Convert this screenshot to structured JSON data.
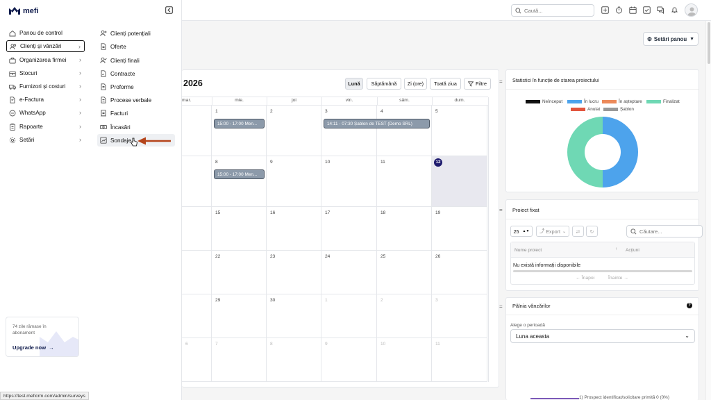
{
  "brand": {
    "name": "mefi"
  },
  "sidebar": {
    "items": [
      {
        "label": "Panou de control",
        "icon": "home-icon"
      },
      {
        "label": "Clienți și vânzări",
        "icon": "users-icon",
        "active": true,
        "chevron": true
      },
      {
        "label": "Organizarea firmei",
        "icon": "briefcase-icon",
        "chevron": true
      },
      {
        "label": "Stocuri",
        "icon": "box-icon",
        "chevron": true
      },
      {
        "label": "Furnizori și costuri",
        "icon": "truck-icon",
        "chevron": true
      },
      {
        "label": "e-Factura",
        "icon": "file-icon",
        "chevron": true
      },
      {
        "label": "WhatsApp",
        "icon": "chat-icon",
        "chevron": true
      },
      {
        "label": "Rapoarte",
        "icon": "report-icon",
        "chevron": true
      },
      {
        "label": "Setări",
        "icon": "gear-icon",
        "chevron": true
      }
    ],
    "subscription": {
      "text": "74 zile rămase în abonament",
      "upgrade_label": "Upgrade now"
    }
  },
  "submenu": {
    "items": [
      {
        "label": "Clienți potențiali",
        "icon": "user-plus-icon"
      },
      {
        "label": "Oferte",
        "icon": "document-icon"
      },
      {
        "label": "Clienți finali",
        "icon": "user-check-icon"
      },
      {
        "label": "Contracte",
        "icon": "contract-icon"
      },
      {
        "label": "Proforme",
        "icon": "document-icon"
      },
      {
        "label": "Procese verbale",
        "icon": "document-icon"
      },
      {
        "label": "Facturi",
        "icon": "invoice-icon"
      },
      {
        "label": "Încasări",
        "icon": "cash-icon"
      },
      {
        "label": "Sondaje",
        "icon": "chart-icon",
        "active": true
      }
    ]
  },
  "topbar": {
    "search_placeholder": "Caută..."
  },
  "dashboard": {
    "settings_label": "Setări panou"
  },
  "calendar": {
    "title": "2026",
    "view_buttons": [
      "Lună",
      "Săptămână",
      "Zi (ore)",
      "Toată ziua"
    ],
    "filters_label": "Filtre",
    "weekdays": [
      "mar.",
      "mie.",
      "joi",
      "vin.",
      "sâm.",
      "dum."
    ],
    "weeks": [
      [
        {
          "d": ""
        },
        {
          "d": "1"
        },
        {
          "d": "2"
        },
        {
          "d": "3"
        },
        {
          "d": "4"
        },
        {
          "d": "5"
        }
      ],
      [
        {
          "d": ""
        },
        {
          "d": "8"
        },
        {
          "d": "9"
        },
        {
          "d": "10"
        },
        {
          "d": "11"
        },
        {
          "d": "12",
          "today": true
        }
      ],
      [
        {
          "d": ""
        },
        {
          "d": "15"
        },
        {
          "d": "16"
        },
        {
          "d": "17"
        },
        {
          "d": "18"
        },
        {
          "d": "19"
        }
      ],
      [
        {
          "d": ""
        },
        {
          "d": "22"
        },
        {
          "d": "23"
        },
        {
          "d": "24"
        },
        {
          "d": "25"
        },
        {
          "d": "26"
        }
      ],
      [
        {
          "d": ""
        },
        {
          "d": "29"
        },
        {
          "d": "30"
        },
        {
          "d": "1",
          "muted": true
        },
        {
          "d": "2",
          "muted": true
        },
        {
          "d": "3",
          "muted": true
        }
      ],
      [
        {
          "d": "6",
          "muted": true
        },
        {
          "d": "7",
          "muted": true
        },
        {
          "d": "8",
          "muted": true
        },
        {
          "d": "9",
          "muted": true
        },
        {
          "d": "10",
          "muted": true
        },
        {
          "d": "11",
          "muted": true
        }
      ]
    ],
    "events": [
      {
        "label": "15:00 - 17:00 Men...",
        "week": 0,
        "col": 1,
        "span": 1
      },
      {
        "label": "14:11 - 07:30 Șablon de TEST (Demo SRL)",
        "week": 0,
        "col": 3,
        "span": 2
      },
      {
        "label": "15:00 - 17:00 Men...",
        "week": 1,
        "col": 1,
        "span": 1
      }
    ]
  },
  "stats": {
    "title": "Statistici în funcție de starea proiectului",
    "legend": [
      {
        "label": "Neînceput",
        "color": "#111111"
      },
      {
        "label": "În lucru",
        "color": "#4da3ec"
      },
      {
        "label": "În așteptare",
        "color": "#ec8a5a"
      },
      {
        "label": "Finalizat",
        "color": "#6fd8b4"
      },
      {
        "label": "Anulat",
        "color": "#e2553e"
      },
      {
        "label": "Șablon",
        "color": "#999999"
      }
    ],
    "chart_data": {
      "type": "pie",
      "categories": [
        "Neînceput",
        "În lucru",
        "În așteptare",
        "Finalizat",
        "Anulat",
        "Șablon"
      ],
      "values": [
        0,
        50,
        0,
        50,
        0,
        0
      ],
      "title": ""
    }
  },
  "projects": {
    "title": "Proiect fixat",
    "page_size": "25",
    "export_label": "Export",
    "search_placeholder": "Căutare...",
    "columns": [
      "Nume proiect",
      "Acțiuni"
    ],
    "empty_text": "Nu există informații disponibile",
    "prev_label": "← Înapoi",
    "next_label": "Înainte →"
  },
  "funnel": {
    "title": "Pâlnia vânzărilor",
    "period_label": "Alege o perioadă",
    "period_value": "Luna aceasta",
    "stage_text": "1) Prospect identificat/solicitare primită 0 (0%)"
  },
  "statusbar": {
    "url": "https://test.meficrm.com/admin/surveys"
  }
}
